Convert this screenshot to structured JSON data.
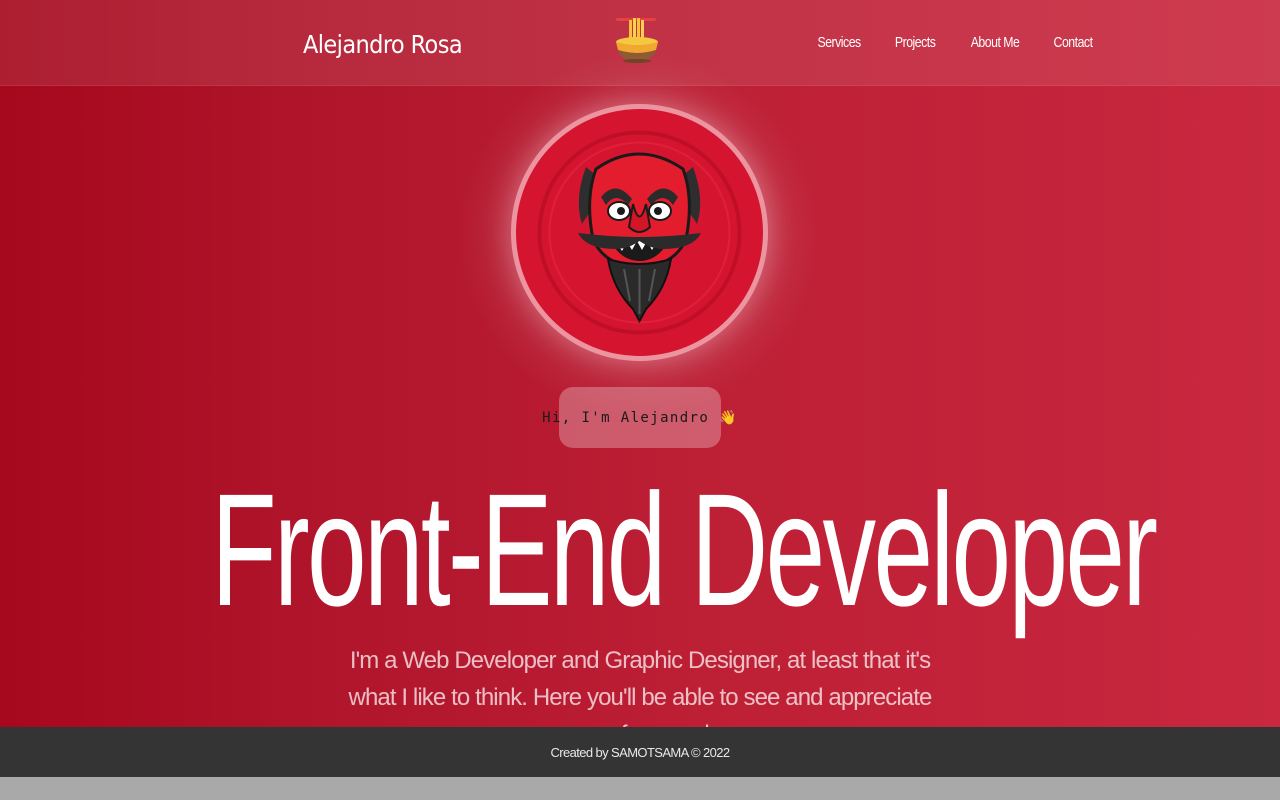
{
  "header": {
    "brand": "Alejandro Rosa",
    "logo_icon": "ramen-bowl-icon",
    "nav": [
      "Services",
      "Projects",
      "About Me",
      "Contact"
    ]
  },
  "hero": {
    "avatar_icon": "tengu-mask-icon",
    "greeting": "Hi, I'm Alejandro 👋",
    "title": "Front-End Developer",
    "description": "I'm a Web Developer and Graphic Designer, at least that it's what I like to think. Here you'll be able to see and appreciate some of my works."
  },
  "footer": {
    "credit": "Created by SAMOTSAMA © 2022"
  },
  "colors": {
    "hero_start": "#a6081d",
    "hero_end": "#c9283f",
    "avatar_bg": "#d51530",
    "footer_bg": "#343434"
  }
}
